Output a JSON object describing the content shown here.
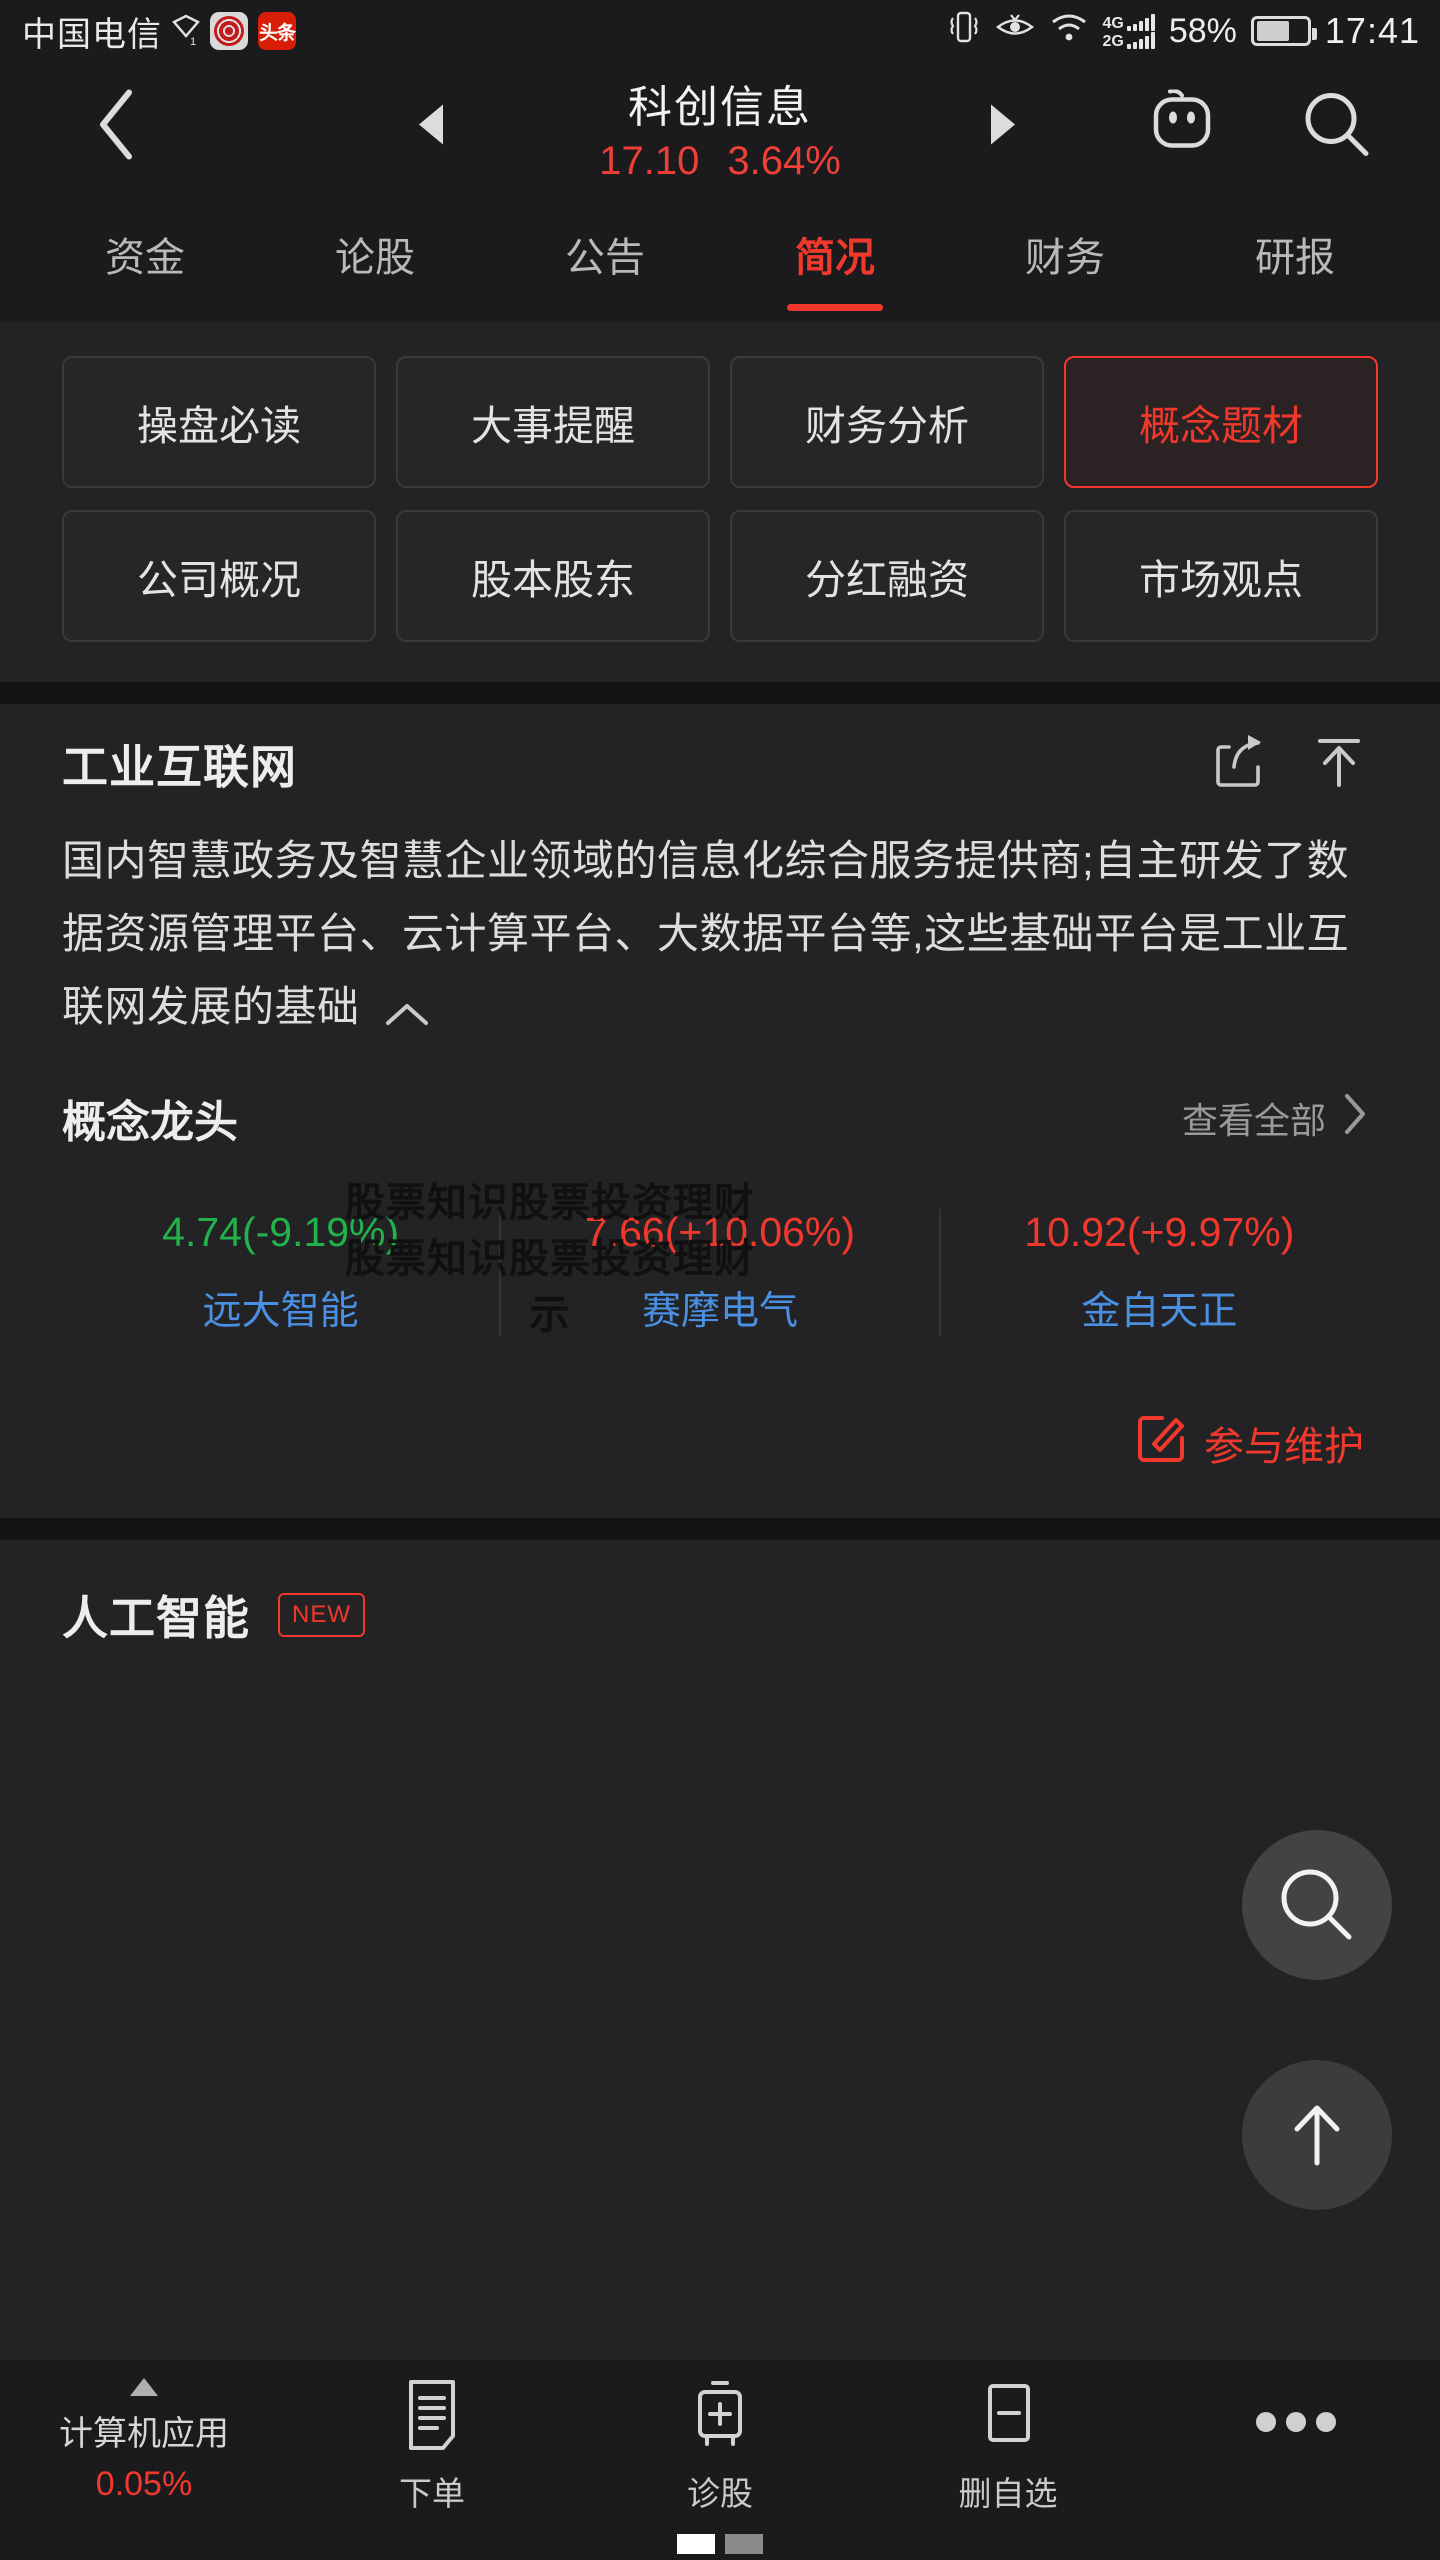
{
  "statusbar": {
    "carrier": "中国电信",
    "app_badges": [
      "weibo-icon",
      "toutiao-icon"
    ],
    "network_primary": "4G",
    "network_secondary": "2G",
    "battery_percent": "58%",
    "time": "17:41",
    "icons": [
      "location-icon",
      "vibrate-icon",
      "eye-icon",
      "wifi-icon",
      "signal-icon",
      "battery-icon"
    ]
  },
  "header": {
    "title": "科创信息",
    "price": "17.10",
    "change_percent": "3.64%",
    "accent_color": "#ef3f36",
    "icons": [
      "back-icon",
      "prev-icon",
      "next-icon",
      "robot-icon",
      "search-icon"
    ]
  },
  "tabs": [
    {
      "label": "资金",
      "active": false
    },
    {
      "label": "论股",
      "active": false
    },
    {
      "label": "公告",
      "active": false
    },
    {
      "label": "简况",
      "active": true
    },
    {
      "label": "财务",
      "active": false
    },
    {
      "label": "研报",
      "active": false
    }
  ],
  "chips": {
    "row1": [
      {
        "label": "操盘必读",
        "selected": false
      },
      {
        "label": "大事提醒",
        "selected": false
      },
      {
        "label": "财务分析",
        "selected": false
      },
      {
        "label": "概念题材",
        "selected": true
      }
    ],
    "row2": [
      {
        "label": "公司概况",
        "selected": false
      },
      {
        "label": "股本股东",
        "selected": false
      },
      {
        "label": "分红融资",
        "selected": false
      },
      {
        "label": "市场观点",
        "selected": false
      }
    ]
  },
  "concept": {
    "title": "工业互联网",
    "share_icon": "share-icon",
    "collapse_icon": "collapse-up-icon",
    "description": "国内智慧政务及智慧企业领域的信息化综合服务提供商;自主研发了数据资源管理平台、云计算平台、大数据平台等,这些基础平台是工业互联网发展的基础",
    "expand_caret": "chevron-up-icon",
    "leaders_title": "概念龙头",
    "view_all": "查看全部",
    "view_all_chevron": "chevron-right-icon",
    "leaders": [
      {
        "quote": "4.74(-9.19%)",
        "name": "远大智能",
        "direction": "down"
      },
      {
        "quote": "7.66(+10.06%)",
        "name": "赛摩电气",
        "direction": "up"
      },
      {
        "quote": "10.92(+9.97%)",
        "name": "金自天正",
        "direction": "up"
      }
    ],
    "maintain_label": "参与维护",
    "maintain_icon": "edit-icon"
  },
  "ai_section": {
    "title": "人工智能",
    "badge": "NEW"
  },
  "watermark": "股票知识股票投资理财股票知识股票投资理财示",
  "floating": {
    "search_icon": "search-icon",
    "back_to_top_icon": "arrow-up-icon"
  },
  "bottombar": {
    "sector_name": "计算机应用",
    "sector_change": "0.05%",
    "sector_trend_icon": "triangle-up-icon",
    "items": [
      {
        "label": "下单",
        "icon": "order-form-icon"
      },
      {
        "label": "诊股",
        "icon": "diagnose-plus-icon"
      },
      {
        "label": "删自选",
        "icon": "remove-minus-icon"
      }
    ],
    "more_icon": "more-dots-icon"
  },
  "colors": {
    "up": "#f0392c",
    "down": "#22b24c",
    "link": "#4a90e2",
    "bg": "#232325",
    "bar_bg": "#1b1b1d"
  }
}
